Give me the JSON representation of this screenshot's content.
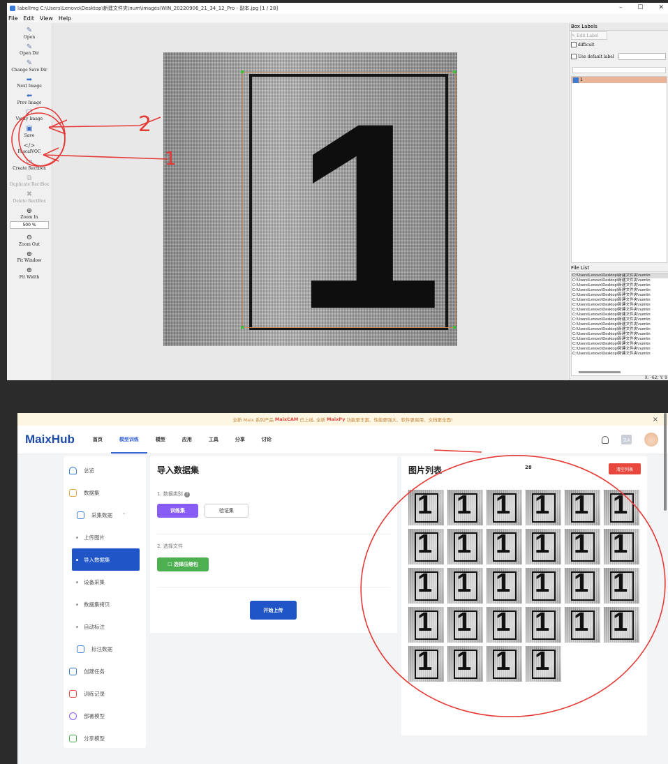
{
  "labelimg": {
    "title": "labelImg C:\\Users\\Lenovo\\Desktop\\新建文件夹\\num\\images\\WIN_20220906_21_34_12_Pro - 副本.jpg [1 / 28]",
    "window_controls": [
      "–",
      "☐",
      "✕"
    ],
    "menu": [
      "File",
      "Edit",
      "View",
      "Help"
    ],
    "tools": [
      {
        "label": "Open",
        "icon": "folder-icon",
        "enabled": true
      },
      {
        "label": "Open Dir",
        "icon": "folder-icon",
        "enabled": true
      },
      {
        "label": "Change Save Dir",
        "icon": "folder-icon",
        "enabled": true
      },
      {
        "label": "Next Image",
        "icon": "arrow-right-icon",
        "enabled": true
      },
      {
        "label": "Prev Image",
        "icon": "arrow-left-icon",
        "enabled": true
      },
      {
        "label": "Verify Image",
        "icon": "verify-icon",
        "enabled": true
      },
      {
        "label": "Save",
        "icon": "save-icon",
        "enabled": true
      },
      {
        "label": "PascalVOC",
        "icon": "format-icon",
        "enabled": true
      },
      {
        "label": "Create RectBox",
        "icon": "rect-icon",
        "enabled": true
      },
      {
        "label": "Duplicate RectBox",
        "icon": "duplicate-icon",
        "enabled": false
      },
      {
        "label": "Delete RectBox",
        "icon": "delete-icon",
        "enabled": false
      },
      {
        "label": "Zoom In",
        "icon": "zoom-in-icon",
        "enabled": true
      }
    ],
    "zoom_value": "500 %",
    "tools_bottom": [
      {
        "label": "Zoom Out",
        "icon": "zoom-out-icon"
      },
      {
        "label": "Fit Window",
        "icon": "fit-window-icon"
      },
      {
        "label": "Fit Width",
        "icon": "fit-width-icon"
      }
    ],
    "box_labels_title": "Box Labels",
    "edit_label": "Edit Label",
    "difficult": "difficult",
    "use_default_label": "Use default label",
    "labels": [
      {
        "text": "1",
        "checked": true
      }
    ],
    "file_list_title": "File List",
    "file_item": "C:\\Users\\Lenovo\\Desktop\\新建文件夹\\num\\in",
    "file_count_shown": 17,
    "status_coord": "X: -62; Y: 9"
  },
  "maixhub": {
    "banner": {
      "pre": "全新 Maix 系列产品",
      "b1": "MaixCAM",
      "mid": "已上线, 全新",
      "b2": "MaixPy",
      "post": "功能更丰富、性能更强大、软件更易用、文档更全面!",
      "close": "×"
    },
    "logo": "MaixHub",
    "nav": [
      {
        "label": "首页",
        "active": false
      },
      {
        "label": "模型训练",
        "active": true
      },
      {
        "label": "模型",
        "active": false
      },
      {
        "label": "应用",
        "active": false
      },
      {
        "label": "工具",
        "active": false
      },
      {
        "label": "分享",
        "active": false
      },
      {
        "label": "讨论",
        "active": false
      }
    ],
    "lang_icon": "文A",
    "sidebar": [
      {
        "label": "总览",
        "icon": "home-icon",
        "level": 0
      },
      {
        "label": "数据集",
        "icon": "dataset-icon",
        "level": 0
      },
      {
        "label": "采集数据",
        "icon": "collect-icon",
        "level": 1,
        "caret": "^"
      },
      {
        "label": "上传图片",
        "level": 2
      },
      {
        "label": "导入数据集",
        "level": 2,
        "active": true
      },
      {
        "label": "设备采集",
        "level": 2
      },
      {
        "label": "数据集拷贝",
        "level": 2
      },
      {
        "label": "自动标注",
        "level": 2
      },
      {
        "label": "标注数据",
        "icon": "annotate-icon",
        "level": 1
      },
      {
        "label": "创建任务",
        "icon": "plus-icon",
        "level": 0
      },
      {
        "label": "训练记录",
        "icon": "history-icon",
        "level": 0
      },
      {
        "label": "部署模型",
        "icon": "cube-icon",
        "level": 0
      },
      {
        "label": "分享模型",
        "icon": "share-icon",
        "level": 0
      }
    ],
    "import": {
      "title": "导入数据集",
      "step1": "1. 数据类别",
      "help": "?",
      "btn_train": "训练集",
      "btn_valid": "验证集",
      "step2": "2. 选择文件",
      "btn_choose": "☐ 选择压缩包",
      "btn_upload": "开始上传"
    },
    "imglist": {
      "title": "图片列表",
      "count": "28",
      "clear": "清空列表",
      "thumb_digits": [
        "1",
        "1",
        "1",
        "1",
        "1",
        "1",
        "1",
        "1",
        "1",
        "1",
        "1",
        "1",
        "1",
        "1",
        "1",
        "1",
        "1",
        "1",
        "1",
        "1",
        "1",
        "1",
        "1",
        "1",
        "1",
        "1",
        "1",
        "1"
      ]
    },
    "colors": {
      "brand": "#1e4aa8",
      "active": "#1f55c6",
      "purple": "#8a5cf6",
      "green": "#4caf50",
      "red": "#e8473d",
      "annotation": "#e53935"
    }
  },
  "annotations": {
    "num1": "1",
    "num2": "2"
  }
}
